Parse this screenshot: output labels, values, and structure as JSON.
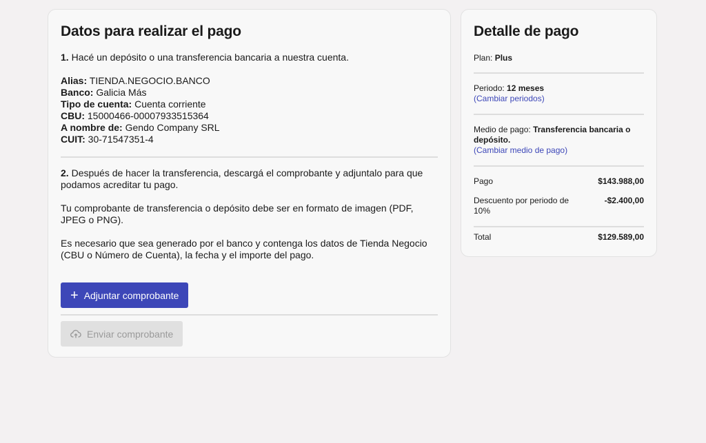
{
  "main": {
    "title": "Datos para realizar el pago",
    "step1_number": "1.",
    "step1_text": " Hacé un depósito o una transferencia bancaria a nuestra cuenta.",
    "details": [
      {
        "label": "Alias:",
        "value": " TIENDA.NEGOCIO.BANCO"
      },
      {
        "label": "Banco:",
        "value": " Galicia Más"
      },
      {
        "label": "Tipo de cuenta:",
        "value": " Cuenta corriente"
      },
      {
        "label": "CBU:",
        "value": " 15000466-00007933515364"
      },
      {
        "label": "A nombre de:",
        "value": " Gendo Company SRL"
      },
      {
        "label": "CUIT:",
        "value": " 30-71547351-4"
      }
    ],
    "step2_number": "2.",
    "step2_text": " Después de hacer la transferencia, descargá el comprobante y adjuntalo para que podamos acreditar tu pago.",
    "format_note": "Tu comprobante de transferencia o depósito debe ser en formato de imagen (PDF, JPEG o PNG).",
    "bank_note": "Es necesario que sea generado por el banco y contenga los datos de Tienda Negocio (CBU o Número de Cuenta), la fecha y el importe del pago.",
    "attach_label": "Adjuntar comprobante",
    "send_label": "Enviar comprobante"
  },
  "summary": {
    "title": "Detalle de pago",
    "plan_label": "Plan: ",
    "plan_value": "Plus",
    "period_label": "Periodo: ",
    "period_value": "12 meses",
    "change_period": "(Cambiar periodos)",
    "method_label": "Medio de pago: ",
    "method_value": "Transferencia bancaria o depósito.",
    "change_method": "(Cambiar medio de pago)",
    "pay_label": "Pago",
    "pay_value": "$143.988,00",
    "discount_label": "Descuento por periodo de 10%",
    "discount_value": "-$2.400,00",
    "total_label": "Total",
    "total_value": "$129.589,00"
  },
  "colors": {
    "accent": "#3d47b8",
    "background": "#f3f1f2",
    "card": "#f8f8f8",
    "disabled": "#e0e0e0"
  },
  "icons": {
    "attach": "plus-icon",
    "send": "cloud-upload-icon"
  }
}
